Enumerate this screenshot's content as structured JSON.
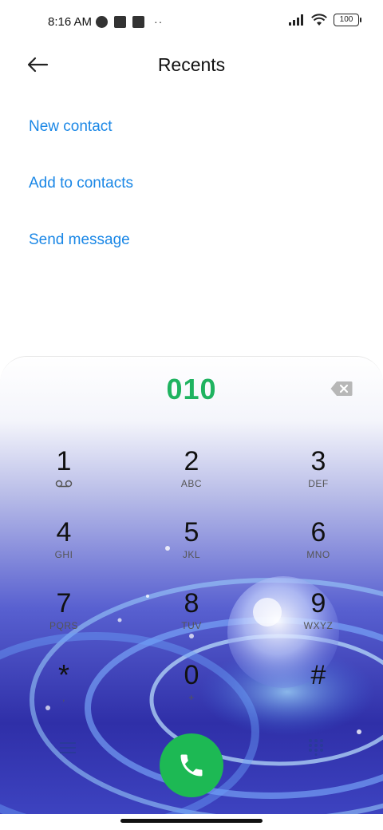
{
  "status_bar": {
    "time": "8:16 AM",
    "battery": "100"
  },
  "header": {
    "back_icon": "arrow-left-icon",
    "title": "Recents"
  },
  "actions": {
    "new_contact": "New contact",
    "add_to_contacts": "Add to contacts",
    "send_message": "Send message"
  },
  "dialer": {
    "number": "010",
    "keys": [
      {
        "digit": "1",
        "letters": ""
      },
      {
        "digit": "2",
        "letters": "ABC"
      },
      {
        "digit": "3",
        "letters": "DEF"
      },
      {
        "digit": "4",
        "letters": "GHI"
      },
      {
        "digit": "5",
        "letters": "JKL"
      },
      {
        "digit": "6",
        "letters": "MNO"
      },
      {
        "digit": "7",
        "letters": "PQRS"
      },
      {
        "digit": "8",
        "letters": "TUV"
      },
      {
        "digit": "9",
        "letters": "WXYZ"
      },
      {
        "digit": "*",
        "letters": ","
      },
      {
        "digit": "0",
        "letters": "+"
      },
      {
        "digit": "#",
        "letters": ""
      }
    ]
  },
  "colors": {
    "accent_blue": "#1a87e6",
    "number_green": "#1fb360",
    "call_green": "#1db954"
  }
}
